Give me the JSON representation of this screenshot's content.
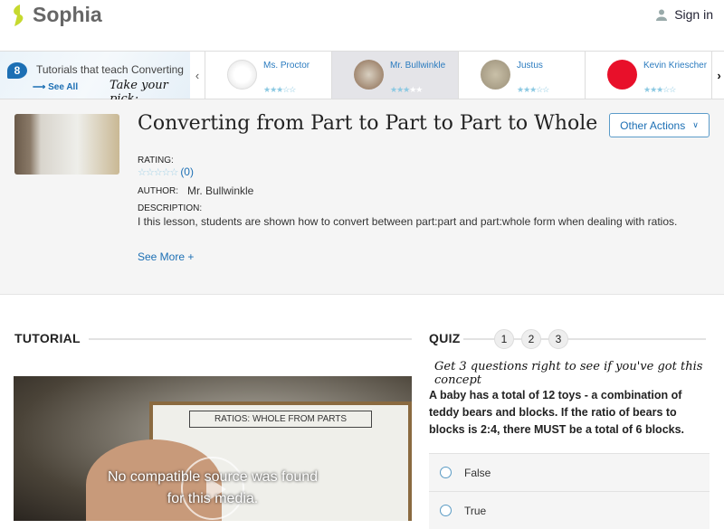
{
  "header": {
    "brand": "Sophia",
    "sign_in": "Sign in"
  },
  "carousel": {
    "count": "8",
    "title": "Tutorials that teach Converting from Part to Part to Part to Whole",
    "see_all": "See All",
    "pick": "Take your pick:",
    "items": [
      {
        "name": "Ms. Proctor",
        "rating": 3
      },
      {
        "name": "Mr. Bullwinkle",
        "rating": 3
      },
      {
        "name": "Justus",
        "rating": 3
      },
      {
        "name": "Kevin Kriescher",
        "rating": 3
      }
    ]
  },
  "tutorial": {
    "title": "Converting from Part to Part to Part to Whole",
    "other_actions": "Other Actions",
    "rating_label": "RATING:",
    "rating_count": "(0)",
    "author_label": "AUTHOR:",
    "author": "Mr. Bullwinkle",
    "description_label": "DESCRIPTION:",
    "description": "I this lesson, students are shown how to convert between part:part and part:whole form when dealing with ratios.",
    "see_more": "See More +"
  },
  "section": {
    "tutorial_heading": "TUTORIAL",
    "video_message_1": "No compatible source was found",
    "video_message_2": "for this media.",
    "board_title": "RATIOS: WHOLE FROM PARTS"
  },
  "quiz": {
    "heading": "QUIZ",
    "steps": [
      "1",
      "2",
      "3"
    ],
    "prompt": "Get 3 questions right to see if you've got this concept",
    "question": "A baby has a total of 12 toys - a combination of teddy bears and blocks. If the ratio of bears to blocks is 2:4, there MUST be a total of 6 blocks.",
    "options": [
      "False",
      "True"
    ]
  }
}
